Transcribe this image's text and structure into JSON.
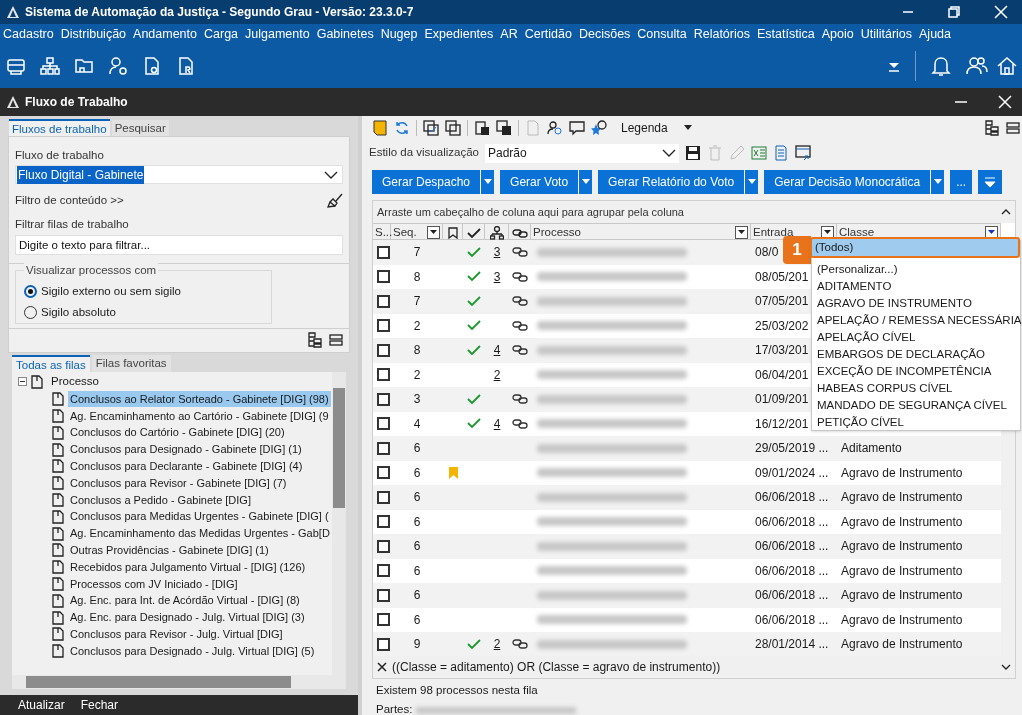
{
  "window": {
    "title": "Sistema de Automação da Justiça - Segundo Grau - Versão: 23.3.0-7"
  },
  "menu": [
    "Cadastro",
    "Distribuição",
    "Andamento",
    "Carga",
    "Julgamento",
    "Gabinetes",
    "Nugep",
    "Expedientes",
    "AR",
    "Certidão",
    "Decisões",
    "Consulta",
    "Relatórios",
    "Estatística",
    "Apoio",
    "Utilitários",
    "Ajuda"
  ],
  "panel": {
    "title": "Fluxo de Trabalho"
  },
  "left": {
    "tabs": [
      {
        "label": "Fluxos de trabalho",
        "selected": true
      },
      {
        "label": "Pesquisar",
        "selected": false
      }
    ],
    "workflow_label": "Fluxo de trabalho",
    "workflow_value": "Fluxo Digital - Gabinete",
    "content_filter": "Filtro de conteúdo >>",
    "queue_filter_label": "Filtrar filas de trabalho",
    "queue_filter_placeholder": "Digite o texto para filtrar...",
    "visibility": {
      "legend": "Visualizar processos com",
      "options": [
        {
          "label": "Sigilo externo ou sem sigilo",
          "selected": true
        },
        {
          "label": "Sigilo absoluto",
          "selected": false
        }
      ]
    },
    "queue_tabs": [
      {
        "label": "Todas as filas",
        "selected": true
      },
      {
        "label": "Filas favoritas",
        "selected": false
      }
    ],
    "tree": {
      "label": "Processo",
      "expanded": true,
      "children": [
        {
          "label": "Conclusos ao Relator Sorteado - Gabinete [DIG] (98)",
          "selected": true
        },
        {
          "label": "Ag. Encaminhamento ao Cartório - Gabinete [DIG] (9",
          "selected": false
        },
        {
          "label": "Conclusos do Cartório - Gabinete [DIG] (20)",
          "selected": false
        },
        {
          "label": "Conclusos para Designado - Gabinete [DIG] (1)",
          "selected": false
        },
        {
          "label": "Conclusos para Declarante - Gabinete [DIG] (4)",
          "selected": false
        },
        {
          "label": "Conclusos para Revisor - Gabinete [DIG] (7)",
          "selected": false
        },
        {
          "label": "Conclusos a Pedido - Gabinete [DIG]",
          "selected": false
        },
        {
          "label": "Conclusos para Medidas Urgentes - Gabinete [DIG] (",
          "selected": false
        },
        {
          "label": "Ag. Encaminhamento das Medidas Urgentes - Gab[D",
          "selected": false
        },
        {
          "label": "Outras Providências - Gabinete [DIG] (1)",
          "selected": false
        },
        {
          "label": "Recebidos para Julgamento Virtual - [DIG] (126)",
          "selected": false
        },
        {
          "label": "Processos com JV Iniciado - [DIG]",
          "selected": false
        },
        {
          "label": "Ag. Enc. para Int. de Acórdão Virtual - [DIG] (8)",
          "selected": false
        },
        {
          "label": "Ag. Enc. para Designado - Julg. Virtual [DIG] (3)",
          "selected": false
        },
        {
          "label": "Conclusos para Revisor - Julg. Virtual [DIG]",
          "selected": false
        },
        {
          "label": "Conclusos para Designado - Julg. Virtual [DIG] (5)",
          "selected": false
        }
      ]
    },
    "footer_buttons": [
      "Atualizar",
      "Fechar"
    ]
  },
  "right": {
    "legend_label": "Legenda",
    "view_style_label": "Estilo da visualização",
    "view_style_value": "Padrão",
    "action_buttons": [
      "Gerar Despacho",
      "Gerar Voto",
      "Gerar Relatório do Voto",
      "Gerar Decisão Monocrática"
    ],
    "more_button": "...",
    "group_hint": "Arraste um cabeçalho de coluna aqui para agrupar pela coluna",
    "columns": [
      "S...",
      "Seq.",
      "Processo",
      "Entrada",
      "Classe"
    ],
    "rows": [
      {
        "checked": false,
        "seq": "7",
        "bookmarked": false,
        "done": true,
        "count": "3",
        "linked": true,
        "entrada": "08/0"
      },
      {
        "checked": false,
        "seq": "8",
        "bookmarked": false,
        "done": true,
        "count": "3",
        "linked": true,
        "entrada": "08/05/201"
      },
      {
        "checked": false,
        "seq": "7",
        "bookmarked": false,
        "done": true,
        "linked": true,
        "entrada": "07/05/201"
      },
      {
        "checked": false,
        "seq": "2",
        "bookmarked": false,
        "done": true,
        "linked": true,
        "entrada": "25/03/202"
      },
      {
        "checked": false,
        "seq": "8",
        "bookmarked": false,
        "done": true,
        "count": "4",
        "linked": true,
        "entrada": "17/03/201"
      },
      {
        "checked": false,
        "seq": "2",
        "bookmarked": false,
        "done": false,
        "count": "2",
        "linked": false,
        "entrada": "06/04/201"
      },
      {
        "checked": false,
        "seq": "3",
        "bookmarked": false,
        "done": true,
        "linked": true,
        "entrada": "01/09/201"
      },
      {
        "checked": false,
        "seq": "4",
        "bookmarked": false,
        "done": true,
        "count": "4",
        "linked": true,
        "entrada": "16/12/201"
      },
      {
        "checked": false,
        "seq": "6",
        "bookmarked": false,
        "done": false,
        "linked": false,
        "entrada": "29/05/2019 ...",
        "classe": "Aditamento"
      },
      {
        "checked": false,
        "seq": "6",
        "bookmarked": true,
        "done": false,
        "linked": false,
        "entrada": "09/01/2024 ...",
        "classe": "Agravo de Instrumento"
      },
      {
        "checked": false,
        "seq": "6",
        "bookmarked": false,
        "done": false,
        "linked": false,
        "entrada": "06/06/2018 ...",
        "classe": "Agravo de Instrumento"
      },
      {
        "checked": false,
        "seq": "6",
        "bookmarked": false,
        "done": false,
        "linked": false,
        "entrada": "06/06/2018 ...",
        "classe": "Agravo de Instrumento"
      },
      {
        "checked": false,
        "seq": "6",
        "bookmarked": false,
        "done": false,
        "linked": false,
        "entrada": "06/06/2018 ...",
        "classe": "Agravo de Instrumento"
      },
      {
        "checked": false,
        "seq": "6",
        "bookmarked": false,
        "done": false,
        "linked": false,
        "entrada": "06/06/2018 ...",
        "classe": "Agravo de Instrumento"
      },
      {
        "checked": false,
        "seq": "6",
        "bookmarked": false,
        "done": false,
        "linked": false,
        "entrada": "06/06/2018 ...",
        "classe": "Agravo de Instrumento"
      },
      {
        "checked": false,
        "seq": "6",
        "bookmarked": false,
        "done": false,
        "linked": false,
        "entrada": "06/06/2018 ...",
        "classe": "Agravo de Instrumento"
      },
      {
        "checked": false,
        "seq": "9",
        "bookmarked": false,
        "done": true,
        "count": "2",
        "linked": true,
        "entrada": "28/01/2014 ...",
        "classe": "Agravo de Instrumento"
      }
    ],
    "class_filter": {
      "badge": "1",
      "options": [
        {
          "label": "(Todos)",
          "selected": true
        },
        {
          "label": "(Personalizar...)",
          "selected": false
        },
        {
          "label": "ADITAMENTO",
          "selected": false
        },
        {
          "label": "AGRAVO DE INSTRUMENTO",
          "selected": false
        },
        {
          "label": "APELAÇÃO / REMESSA NECESSÁRIA",
          "selected": false
        },
        {
          "label": "APELAÇÃO CÍVEL",
          "selected": false
        },
        {
          "label": "EMBARGOS DE DECLARAÇÃO",
          "selected": false
        },
        {
          "label": "EXCEÇÃO DE INCOMPETÊNCIA",
          "selected": false
        },
        {
          "label": "HABEAS CORPUS CÍVEL",
          "selected": false
        },
        {
          "label": "MANDADO DE SEGURANÇA CÍVEL",
          "selected": false
        },
        {
          "label": "PETIÇÃO CÍVEL",
          "selected": false
        }
      ]
    },
    "filter_expression": "((Classe = aditamento) OR (Classe = agravo de instrumento))",
    "status": "Existem 98 processos nesta fila",
    "partes_label": "Partes:"
  }
}
